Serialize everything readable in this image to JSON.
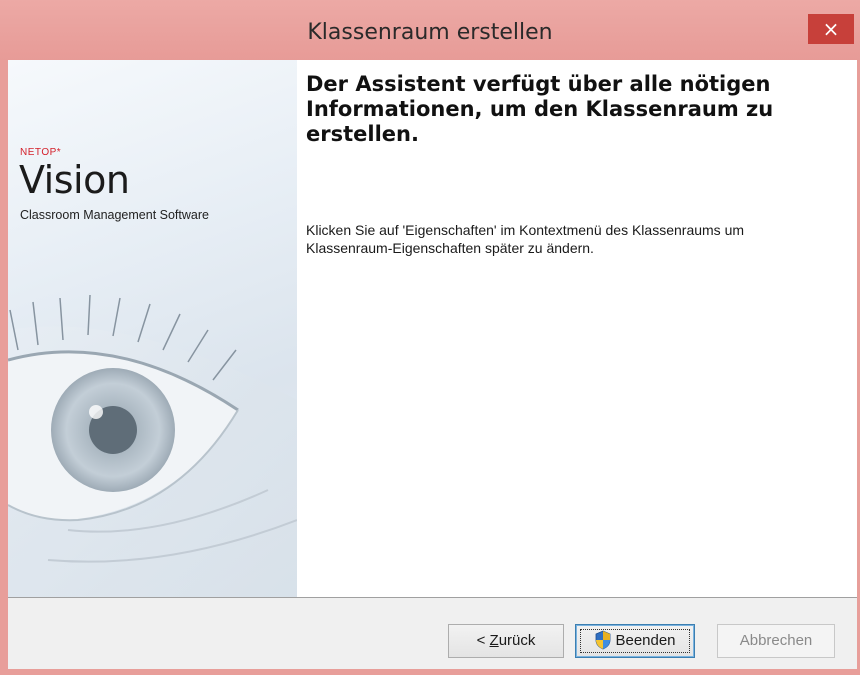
{
  "window": {
    "title": "Klassenraum erstellen",
    "close_glyph": "×"
  },
  "brand": {
    "vendor": "NETOP*",
    "product": "Vision",
    "tagline": "Classroom Management Software"
  },
  "wizard": {
    "heading": "Der Assistent verfügt über alle nötigen Informationen, um den Klassenraum zu erstellen.",
    "description": "Klicken Sie auf 'Eigenschaften' im Kontextmenü des Klassenraums um Klassenraum-Eigenschaften später zu ändern."
  },
  "buttons": {
    "back_prefix": "< ",
    "back_accel": "Z",
    "back_rest": "urück",
    "finish": "Beenden",
    "cancel": "Abbrechen"
  },
  "icons": {
    "close": "close-icon",
    "shield": "uac-shield-icon"
  },
  "colors": {
    "titlebar": "#e79b97",
    "close_button": "#c7403a",
    "brand_red": "#d4202a"
  }
}
